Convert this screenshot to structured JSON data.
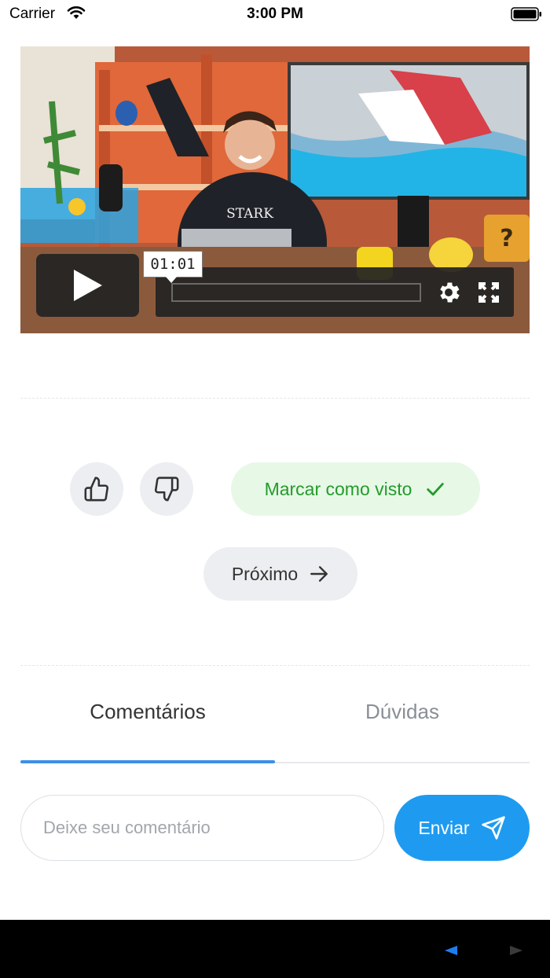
{
  "status_bar": {
    "carrier": "Carrier",
    "time": "3:00 PM"
  },
  "video": {
    "current_time": "01:01",
    "progress": 0.0,
    "shirt_text": "STARK"
  },
  "actions": {
    "mark_watched_label": "Marcar como visto",
    "next_label": "Próximo"
  },
  "tabs": [
    {
      "label": "Comentários",
      "active": true
    },
    {
      "label": "Dúvidas",
      "active": false
    }
  ],
  "comment": {
    "placeholder": "Deixe seu comentário",
    "value": "",
    "send_label": "Enviar"
  },
  "colors": {
    "accent_blue": "#1e9bf0",
    "tab_indicator": "#3d8fe6",
    "mark_green": "#239b2a",
    "mark_bg": "#e7f8e7"
  },
  "icons": [
    "wifi-icon",
    "battery-icon",
    "play-icon",
    "gear-icon",
    "fullscreen-icon",
    "thumbs-up-icon",
    "thumbs-down-icon",
    "check-icon",
    "arrow-right-icon",
    "send-icon",
    "nav-back-icon",
    "nav-forward-icon"
  ]
}
